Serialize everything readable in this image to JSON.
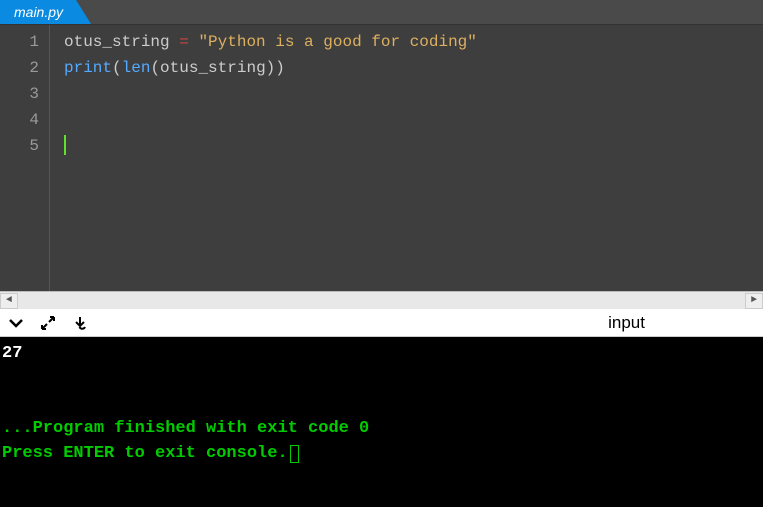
{
  "tab": {
    "filename": "main.py"
  },
  "editor": {
    "line_numbers": [
      "1",
      "2",
      "3",
      "4",
      "5"
    ],
    "lines": {
      "line2": {
        "var": "otus_string",
        "op": " = ",
        "str": "\"Python is a good for coding\""
      },
      "line3": {
        "fn1": "print",
        "p1": "(",
        "fn2": "len",
        "p2": "(",
        "arg": "otus_string",
        "p3": ")",
        "p4": ")"
      }
    }
  },
  "toolbar": {
    "input_label": "input"
  },
  "console": {
    "output": "27",
    "msg1": "...Program finished with exit code 0",
    "msg2": "Press ENTER to exit console."
  }
}
